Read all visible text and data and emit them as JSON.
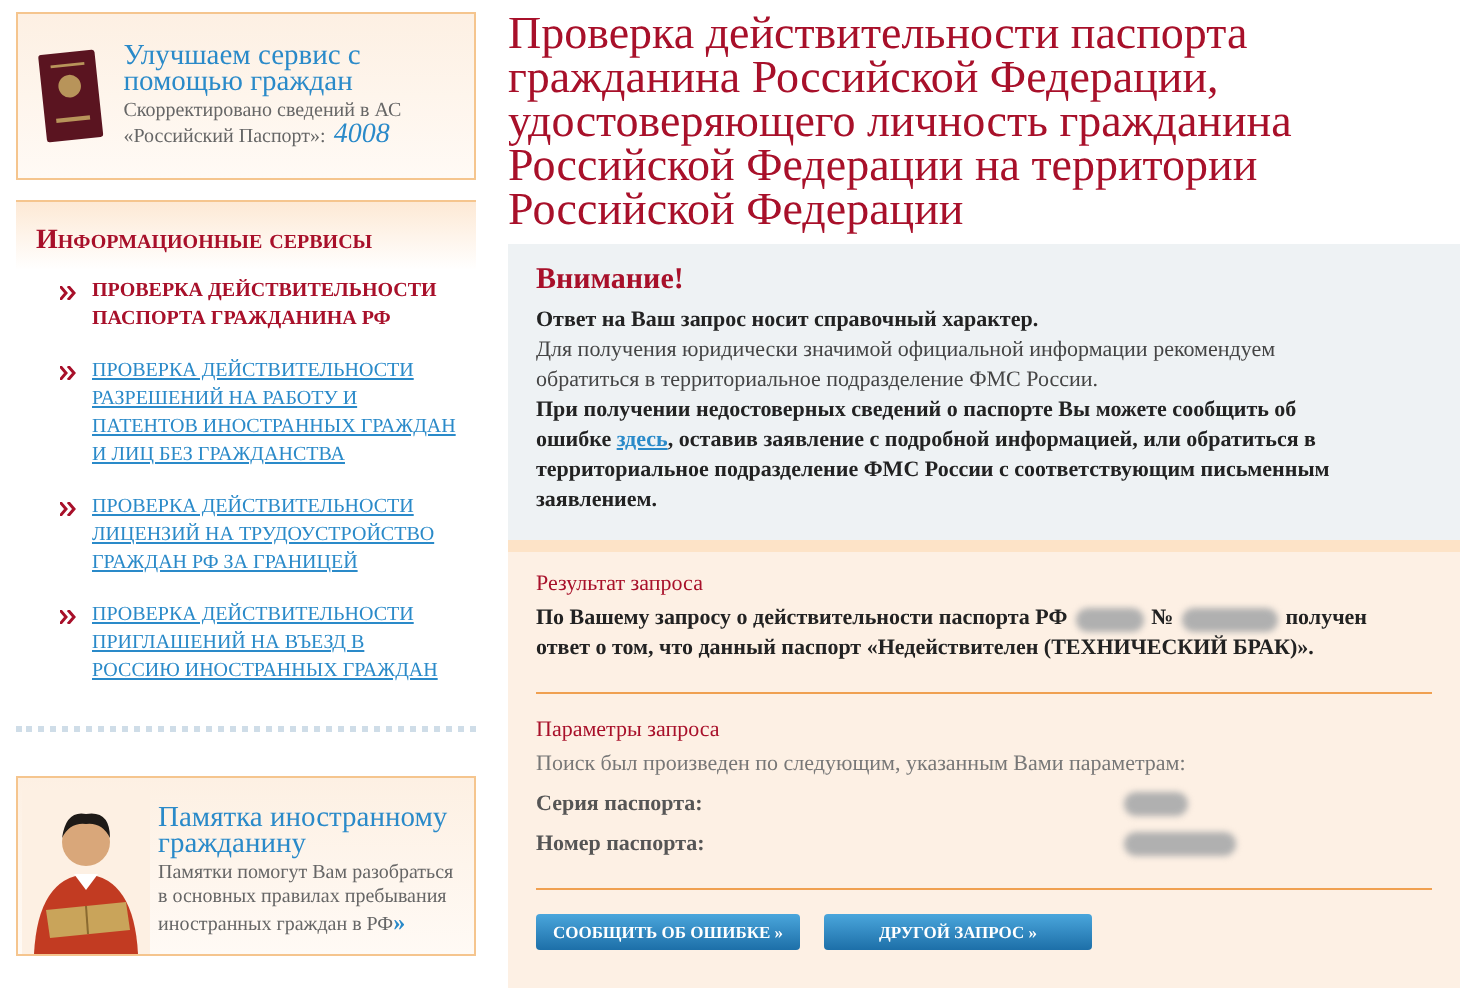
{
  "promo_top": {
    "title": "Улучшаем сервис с помощью граждан",
    "text_lines": [
      "Скорректировано сведений в АС",
      "«Российский Паспорт»:"
    ],
    "count": "4008"
  },
  "services": {
    "title": "Информационные сервисы",
    "items": [
      {
        "label": "ПРОВЕРКА ДЕЙСТВИТЕЛЬНОСТИ ПАСПОРТА ГРАЖДАНИНА РФ",
        "selected": true
      },
      {
        "label": "ПРОВЕРКА ДЕЙСТВИТЕЛЬНОСТИ РАЗРЕШЕНИЙ НА РАБОТУ И ПАТЕНТОВ ИНОСТРАННЫХ ГРАЖДАН И ЛИЦ БЕЗ ГРАЖДАНСТВА",
        "selected": false
      },
      {
        "label": "ПРОВЕРКА ДЕЙСТВИТЕЛЬНОСТИ ЛИЦЕНЗИЙ НА ТРУДОУСТРОЙСТВО ГРАЖДАН РФ ЗА ГРАНИЦЕЙ",
        "selected": false
      },
      {
        "label": "ПРОВЕРКА ДЕЙСТВИТЕЛЬНОСТИ ПРИГЛАШЕНИЙ НА ВЪЕЗД В РОССИЮ ИНОСТРАННЫХ ГРАЖДАН",
        "selected": false
      }
    ]
  },
  "promo_bottom": {
    "title": "Памятка иностранному гражданину",
    "text_lines": [
      "Памятки помогут Вам разобраться",
      "в основных правилах пребывания",
      "иностранных граждан в РФ"
    ],
    "more_link": "»"
  },
  "page_title": "Проверка действительности паспорта гражданина Российской Федерации, удостоверяющего личность гражданина Российской Федерации на территории Российской Федерации",
  "notice": {
    "title": "Внимание!",
    "line_1": "Ответ на Ваш запрос носит справочный характер.",
    "line_2": "Для получения юридически значимой официальной информации рекомендуем обратиться в территориальное подразделение ФМС России.",
    "line_3_before": "При получении недостоверных сведений о паспорте Вы можете сообщить об ошибке",
    "link": "здесь",
    "line_3_after": ", оставив заявление с подробной информацией, или обратиться в территориальное подразделение ФМС России с соответствующим письменным заявлением."
  },
  "result": {
    "heading": "Результат запроса",
    "text_before": "По Вашему запросу о действительности паспорта РФ",
    "number_sign": "№",
    "text_after_line_1": "получен",
    "text_line_2": "ответ о том, что данный паспорт «Недействителен (ТЕХНИЧЕСКИЙ БРАК)»."
  },
  "parameters": {
    "heading": "Параметры запроса",
    "intro": "Поиск был произведен по следующим, указанным Вами параметрам:",
    "fields": [
      {
        "label": "Серия паспорта:"
      },
      {
        "label": "Номер паспорта:"
      }
    ]
  },
  "buttons": [
    "СООБЩИТЬ ОБ ОШИБКЕ »",
    "ДРУГОЙ ЗАПРОС »"
  ]
}
